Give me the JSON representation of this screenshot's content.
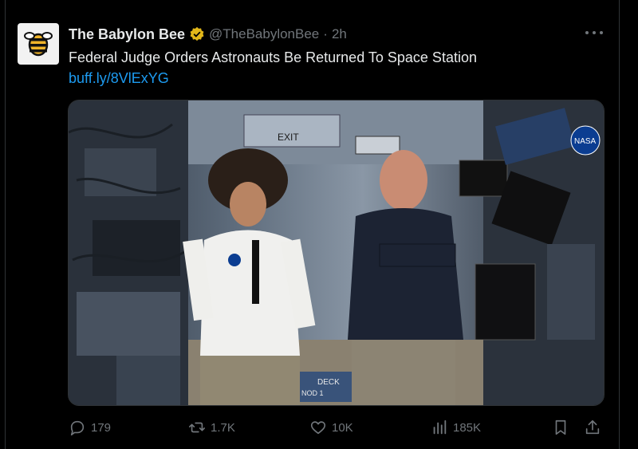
{
  "tweet": {
    "display_name": "The Babylon Bee",
    "handle": "@TheBabylonBee",
    "separator": "·",
    "time": "2h",
    "text": "Federal Judge Orders Astronauts Be Returned To Space Station",
    "link": "buff.ly/8VlExYG"
  },
  "media": {
    "signs": {
      "exit": "EXIT",
      "deck": "DECK",
      "node": "NOD 1"
    },
    "nasa_mark": "NASA"
  },
  "actions": {
    "replies": "179",
    "reposts": "1.7K",
    "likes": "10K",
    "views": "185K"
  },
  "icons": {
    "avatar": "babylon-bee-logo-icon",
    "verified": "verified-badge-icon",
    "more": "more-icon",
    "reply": "reply-icon",
    "repost": "repost-icon",
    "like": "like-icon",
    "views": "views-icon",
    "bookmark": "bookmark-icon",
    "share": "share-icon"
  },
  "colors": {
    "background": "#000000",
    "text": "#e7e9ea",
    "secondary": "#71767b",
    "link": "#1d9bf0",
    "verified_gold": "#e2b719"
  }
}
